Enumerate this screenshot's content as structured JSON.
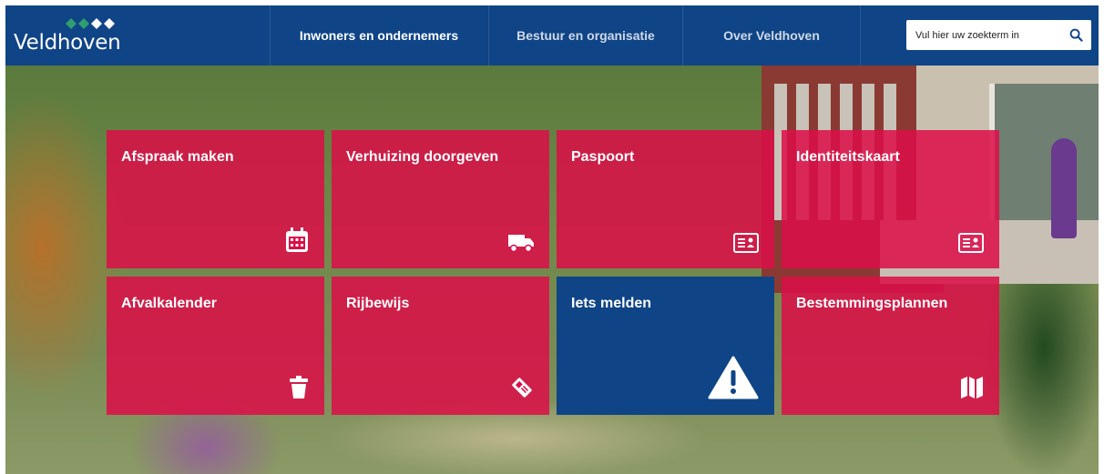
{
  "header": {
    "logo_text": "Veldhoven",
    "nav": [
      {
        "label": "Inwoners en ondernemers",
        "active": true
      },
      {
        "label": "Bestuur en organisatie",
        "active": false
      },
      {
        "label": "Over Veldhoven",
        "active": false
      }
    ],
    "search": {
      "placeholder": "Vul hier uw zoekterm in",
      "icon": "search-icon"
    }
  },
  "tiles": [
    {
      "label": "Afspraak maken",
      "icon": "calendar-icon",
      "color": "#dc0e48"
    },
    {
      "label": "Verhuizing doorgeven",
      "icon": "truck-icon",
      "color": "#dc0e48"
    },
    {
      "label": "Paspoort",
      "icon": "id-card-icon",
      "color": "#dc0e48"
    },
    {
      "label": "Identiteitskaart",
      "icon": "id-card-icon",
      "color": "#dc0e48"
    },
    {
      "label": "Afvalkalender",
      "icon": "trash-icon",
      "color": "#dc0e48"
    },
    {
      "label": "Rijbewijs",
      "icon": "license-icon",
      "color": "#dc0e48"
    },
    {
      "label": "Iets melden",
      "icon": "warning-icon",
      "color": "#0f4486"
    },
    {
      "label": "Bestemmingsplannen",
      "icon": "map-icon",
      "color": "#dc0e48"
    }
  ],
  "colors": {
    "brand_blue": "#0f4486",
    "tile_red": "#dc0e48",
    "logo_green": "#2e9e6e"
  }
}
